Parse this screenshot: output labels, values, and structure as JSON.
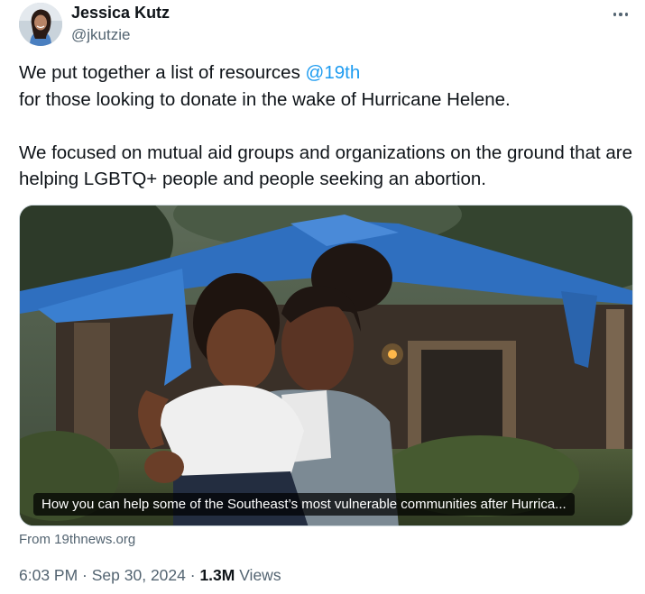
{
  "author": {
    "name": "Jessica Kutz",
    "handle": "@jkutzie",
    "avatar_icon": "profile-photo"
  },
  "more_icon": "more-horizontal-icon",
  "tweet": {
    "line1_prefix": "We put together a list of resources ",
    "mention": "@19th",
    "line2": "for those looking to donate in the wake of Hurricane Helene.",
    "paragraph2": "We focused on mutual aid groups and  organizations on the ground that are helping LGBTQ+ people and people seeking an abortion."
  },
  "card": {
    "caption": "How you can help some of the Southeast’s most vulnerable communities after Hurrica...",
    "source": "From 19thnews.org",
    "image_description": "photo-woman-holding-child-in-front-of-tarp-covered-house"
  },
  "meta": {
    "time": "6:03 PM",
    "separator1": " · ",
    "date": "Sep 30, 2024",
    "separator2": " · ",
    "views_count": "1.3M",
    "views_label": " Views"
  },
  "colors": {
    "text_primary": "#0f1419",
    "text_secondary": "#536471",
    "link": "#1d9bf0",
    "tarp_blue": "#2f6fbf"
  }
}
